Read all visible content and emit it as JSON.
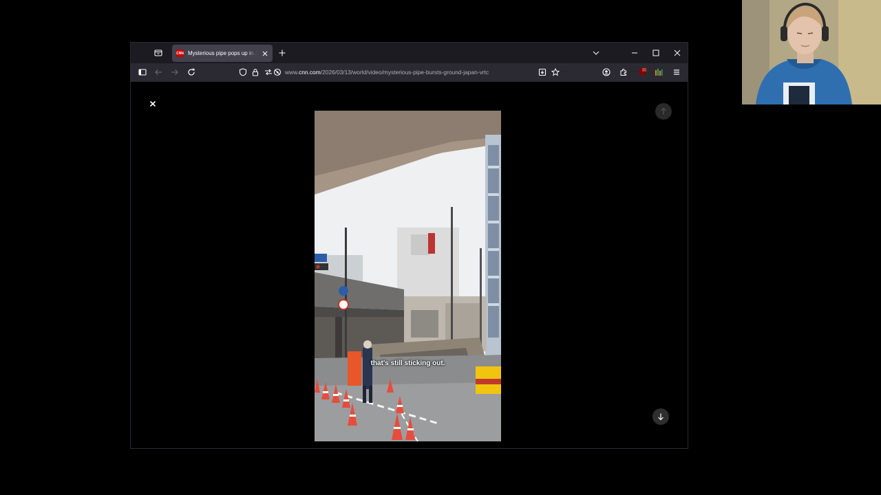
{
  "browser": {
    "tab": {
      "favicon_text": "CNN",
      "title": "Mysterious pipe pops up in Japan"
    },
    "url": {
      "prefix": "www.",
      "host": "cnn.com",
      "path": "/2026/03/13/world/video/mysterious-pipe-bursts-ground-japan-vrtc"
    }
  },
  "video": {
    "caption": "that's still sticking out."
  },
  "colors": {
    "tab_bar": "#1c1b22",
    "nav_bar": "#2b2a33",
    "active_tab": "#42414d",
    "cnn_red": "#cc0000",
    "sweater_blue": "#2f6fb0"
  }
}
